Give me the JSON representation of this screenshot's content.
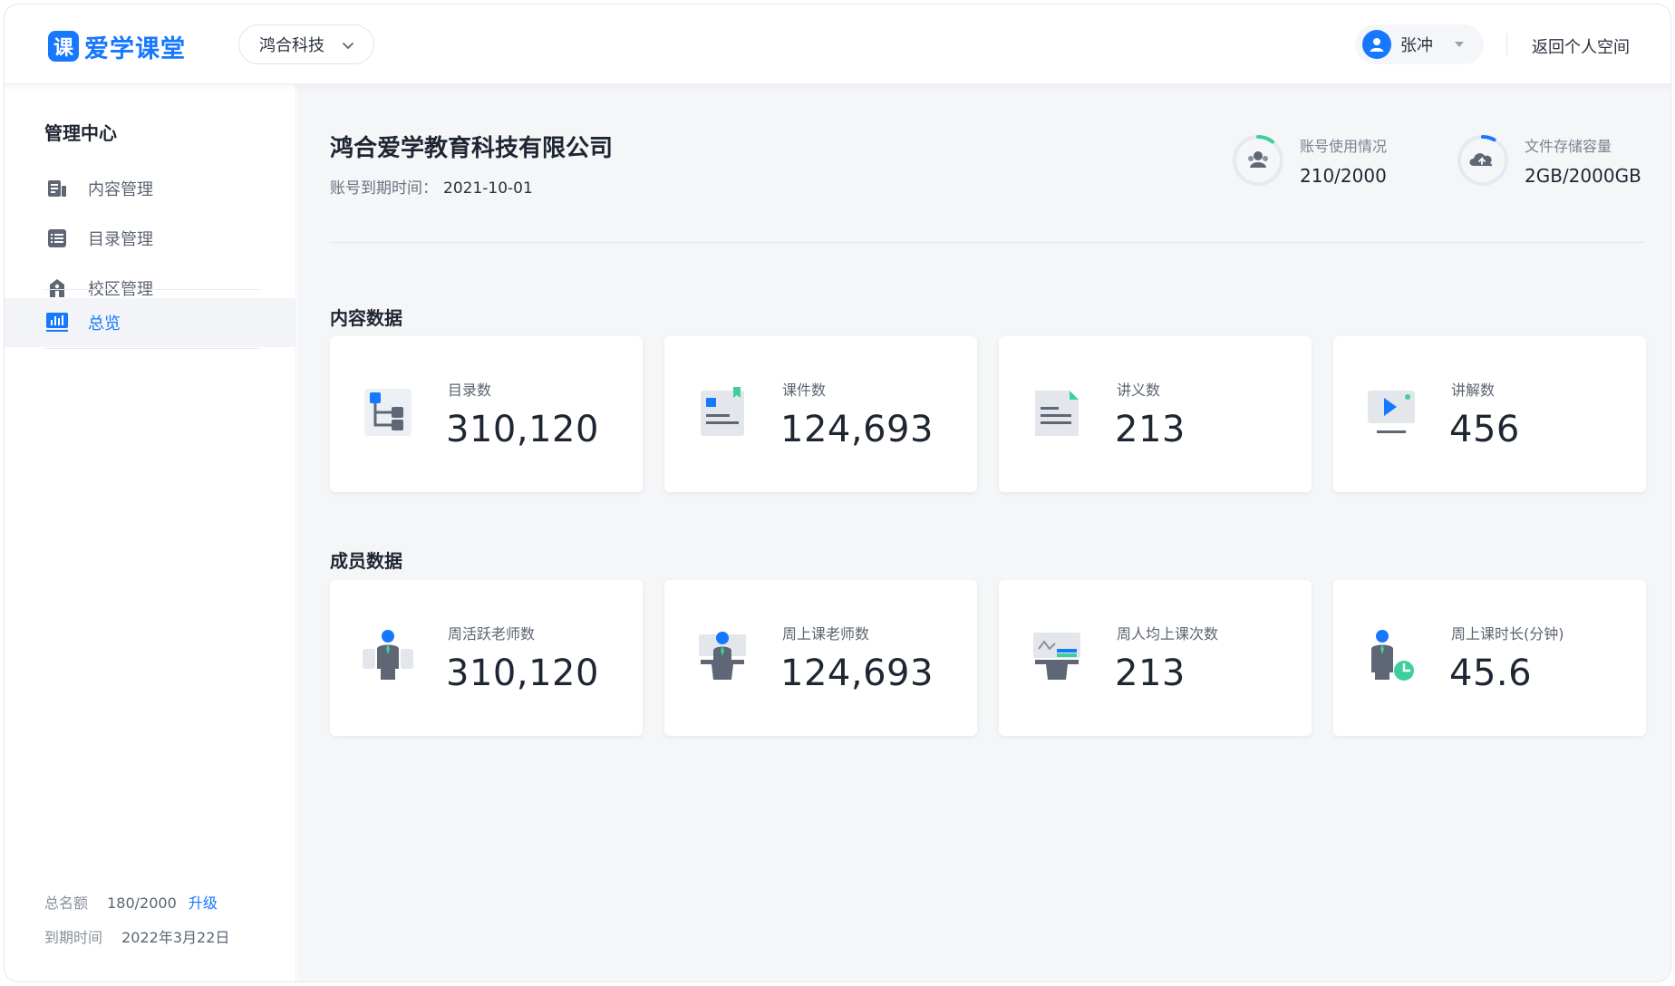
{
  "header": {
    "logo_mark": "课",
    "logo_text": "爱学课堂",
    "org_selected": "鸿合科技",
    "user_name": "张冲",
    "back_link": "返回个人空间"
  },
  "sidebar": {
    "title": "管理中心",
    "items": [
      {
        "label": "内容管理",
        "icon": "document-list-icon"
      },
      {
        "label": "目录管理",
        "icon": "catalog-list-icon"
      },
      {
        "label": "校区管理",
        "icon": "school-building-icon"
      },
      {
        "label": "总览",
        "icon": "bar-chart-icon",
        "active": true
      }
    ],
    "footer": {
      "quota_label": "总名额",
      "quota_value": "180/2000",
      "upgrade_label": "升级",
      "expire_label": "到期时间",
      "expire_value": "2022年3月22日"
    }
  },
  "main": {
    "company_name": "鸿合爱学教育科技有限公司",
    "expire_label": "账号到期时间：",
    "expire_value": "2021-10-01",
    "stats": [
      {
        "label": "账号使用情况",
        "value": "210/2000",
        "used": 210,
        "total": 2000,
        "icon": "user-group-icon"
      },
      {
        "label": "文件存储容量",
        "value": "2GB/2000GB",
        "used": 2,
        "total": 2000,
        "icon": "cloud-upload-icon"
      }
    ],
    "content_section_title": "内容数据",
    "content_cards": [
      {
        "label": "目录数",
        "value": "310,120",
        "icon": "directory-tree-icon"
      },
      {
        "label": "课件数",
        "value": "124,693",
        "icon": "courseware-icon"
      },
      {
        "label": "讲义数",
        "value": "213",
        "icon": "handout-icon"
      },
      {
        "label": "讲解数",
        "value": "456",
        "icon": "video-explain-icon"
      }
    ],
    "member_section_title": "成员数据",
    "member_cards": [
      {
        "label": "周活跃老师数",
        "value": "310,120",
        "icon": "active-teacher-icon"
      },
      {
        "label": "周上课老师数",
        "value": "124,693",
        "icon": "teaching-teacher-icon"
      },
      {
        "label": "周人均上课次数",
        "value": "213",
        "icon": "lecture-count-icon"
      },
      {
        "label": "周上课时长(分钟)",
        "value": "45.6",
        "icon": "teaching-duration-icon"
      }
    ]
  },
  "colors": {
    "accent": "#1677ff",
    "ring_teal": "#3fcf9c",
    "text_primary": "#1f2633",
    "text_secondary": "#5c6472"
  }
}
